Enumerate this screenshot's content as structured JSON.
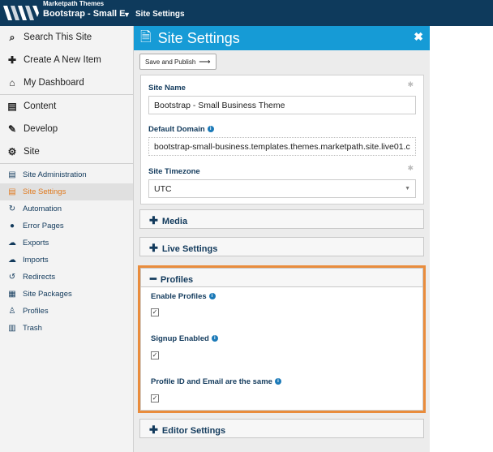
{
  "header": {
    "brand_sub": "Marketpath Themes",
    "site_name": "Bootstrap - Small E",
    "breadcrumb": "Site Settings",
    "bg_color": "#0e3a5c"
  },
  "sidebar": {
    "main_items": [
      {
        "icon": "search-icon",
        "label": "Search This Site"
      },
      {
        "icon": "plus-icon",
        "label": "Create A New Item"
      },
      {
        "icon": "home-icon",
        "label": "My Dashboard"
      },
      {
        "icon": "document-icon",
        "label": "Content"
      },
      {
        "icon": "develop-icon",
        "label": "Develop"
      },
      {
        "icon": "gear-icon",
        "label": "Site"
      }
    ],
    "sub_items": [
      {
        "icon": "document-icon",
        "label": "Site Administration",
        "active": false
      },
      {
        "icon": "document-icon",
        "label": "Site Settings",
        "active": true
      },
      {
        "icon": "automation-icon",
        "label": "Automation",
        "active": false
      },
      {
        "icon": "alert-icon",
        "label": "Error Pages",
        "active": false
      },
      {
        "icon": "cloud-export-icon",
        "label": "Exports",
        "active": false
      },
      {
        "icon": "cloud-import-icon",
        "label": "Imports",
        "active": false
      },
      {
        "icon": "redirect-icon",
        "label": "Redirects",
        "active": false
      },
      {
        "icon": "package-icon",
        "label": "Site Packages",
        "active": false
      },
      {
        "icon": "user-icon",
        "label": "Profiles",
        "active": false
      },
      {
        "icon": "trash-icon",
        "label": "Trash",
        "active": false
      }
    ]
  },
  "panel": {
    "title": "Site Settings",
    "save_label": "Save and Publish",
    "site_name_label": "Site Name",
    "site_name_value": "Bootstrap - Small Business Theme",
    "domain_label": "Default Domain",
    "domain_value": "bootstrap-small-business.templates.themes.marketpath.site.live01.c",
    "timezone_label": "Site Timezone",
    "timezone_value": "UTC",
    "sections": {
      "media": "Media",
      "live": "Live Settings",
      "profiles": "Profiles",
      "editor": "Editor Settings"
    },
    "profiles": {
      "enable_label": "Enable Profiles",
      "signup_label": "Signup Enabled",
      "same_label": "Profile ID and Email are the same"
    },
    "accent_color": "#169bd6",
    "highlight_color": "#e98c3c"
  }
}
